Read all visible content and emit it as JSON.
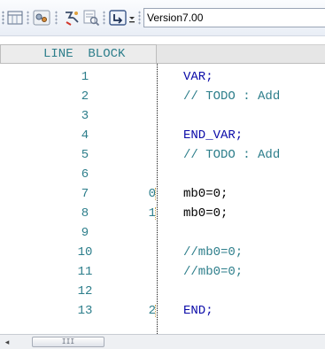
{
  "toolbar": {
    "buttons": [
      {
        "name": "table-view-icon"
      },
      {
        "name": "network-settings-icon"
      },
      {
        "name": "compile-icon"
      },
      {
        "name": "check-code-icon"
      },
      {
        "name": "insert-block-icon"
      },
      {
        "name": "dropdown-arrow-icon"
      }
    ],
    "version_value": "Version7.00"
  },
  "editor": {
    "header_label": "LINE  BLOCK",
    "rows": [
      {
        "line": "1",
        "block": "",
        "code": "VAR;",
        "style": "blue"
      },
      {
        "line": "2",
        "block": "",
        "code": "// TODO : Add",
        "style": "comment"
      },
      {
        "line": "3",
        "block": "",
        "code": "",
        "style": "black"
      },
      {
        "line": "4",
        "block": "",
        "code": "END_VAR;",
        "style": "blue"
      },
      {
        "line": "5",
        "block": "",
        "code": "// TODO : Add",
        "style": "comment"
      },
      {
        "line": "6",
        "block": "",
        "code": "",
        "style": "black"
      },
      {
        "line": "7",
        "block": "0",
        "code": "mb0=0;",
        "style": "black"
      },
      {
        "line": "8",
        "block": "1",
        "code": "mb0=0;",
        "style": "black"
      },
      {
        "line": "9",
        "block": "",
        "code": "",
        "style": "black"
      },
      {
        "line": "10",
        "block": "",
        "code": "//mb0=0;",
        "style": "comment"
      },
      {
        "line": "11",
        "block": "",
        "code": "//mb0=0;",
        "style": "comment"
      },
      {
        "line": "12",
        "block": "",
        "code": "",
        "style": "black"
      },
      {
        "line": "13",
        "block": "2",
        "code": "END;",
        "style": "blue"
      }
    ]
  },
  "scrollbar": {
    "left_arrow": "◂",
    "thumb_grip": "III"
  },
  "colors": {
    "line_number": "#2d7e8b",
    "keyword": "#0a0aa8",
    "comment": "#2d7e8b"
  }
}
